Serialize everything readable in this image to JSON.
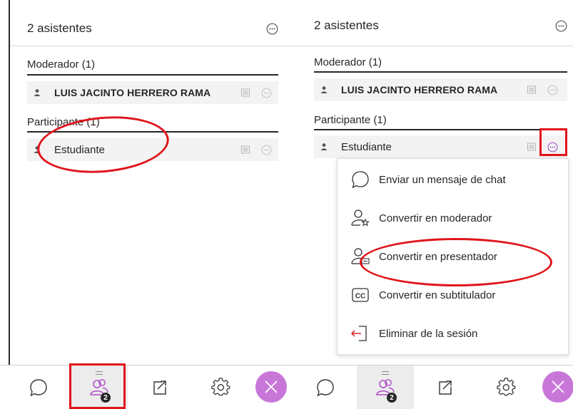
{
  "left_panel": {
    "header": {
      "title": "2 asistentes"
    },
    "moderators": {
      "label": "Moderador (1)",
      "members": [
        {
          "name": "LUIS JACINTO HERRERO RAMA"
        }
      ]
    },
    "participants": {
      "label": "Participante (1)",
      "members": [
        {
          "name": "Estudiante"
        }
      ]
    },
    "tabs": [
      {
        "name": "chat",
        "icon": "chat-bubble-icon"
      },
      {
        "name": "attendees",
        "icon": "people-icon",
        "badge": "2",
        "active": true
      },
      {
        "name": "share-content",
        "icon": "share-icon"
      },
      {
        "name": "settings",
        "icon": "gear-icon"
      },
      {
        "name": "leave",
        "icon": "close-icon"
      }
    ]
  },
  "right_panel": {
    "header": {
      "title": "2 asistentes"
    },
    "moderators": {
      "label": "Moderador (1)",
      "members": [
        {
          "name": "LUIS JACINTO HERRERO RAMA"
        }
      ]
    },
    "participants": {
      "label": "Participante (1)",
      "members": [
        {
          "name": "Estudiante"
        }
      ]
    },
    "context_menu": {
      "items": [
        {
          "label": "Enviar un mensaje de chat",
          "icon": "chat-bubble-icon"
        },
        {
          "label": "Convertir en moderador",
          "icon": "moderator-icon"
        },
        {
          "label": "Convertir en presentador",
          "icon": "presenter-icon"
        },
        {
          "label": "Convertir en subtitulador",
          "icon": "cc-icon"
        },
        {
          "label": "Eliminar de la sesión",
          "icon": "remove-icon"
        }
      ]
    },
    "tabs": [
      {
        "name": "chat",
        "icon": "chat-bubble-icon"
      },
      {
        "name": "attendees",
        "icon": "people-icon",
        "badge": "2",
        "active": true
      },
      {
        "name": "share-content",
        "icon": "share-icon"
      },
      {
        "name": "settings",
        "icon": "gear-icon"
      },
      {
        "name": "leave",
        "icon": "close-icon"
      }
    ]
  },
  "colors": {
    "annotation_red": "#e0141b",
    "row_background": "#f3f3f3",
    "leave_button": "#c877d9",
    "text": "#262626"
  }
}
